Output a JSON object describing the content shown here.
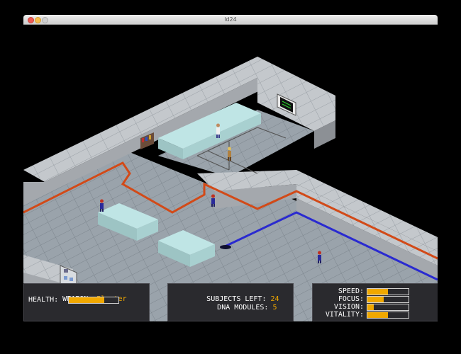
{
  "window": {
    "title": "ld24"
  },
  "hud": {
    "weapon_label": "WEAPON:",
    "weapon_value": "Blaster",
    "health_label": "HEALTH:",
    "health_value": 0.72,
    "subjects_label": "SUBJECTS LEFT:",
    "subjects_value": "24",
    "dna_label": "DNA MODULES:",
    "dna_value": "5",
    "stats": [
      {
        "label": "SPEED:",
        "value": 0.5
      },
      {
        "label": "FOCUS:",
        "value": 0.4
      },
      {
        "label": "VISION:",
        "value": 0.15
      },
      {
        "label": "VITALITY:",
        "value": 0.5
      }
    ]
  },
  "colors": {
    "accent": "#f0a800",
    "floor": "#9aa3ab",
    "wall_top": "#c4c8cc",
    "wall_face": "#a4a8ad",
    "pipe_orange": "#d24a18",
    "pipe_blue": "#2a2ad0",
    "glass": "#bfe5e5",
    "panel_bg": "#2a2a2e"
  },
  "icons": [
    "monitor-icon",
    "wall-panel-icon",
    "door-panel-icon"
  ]
}
